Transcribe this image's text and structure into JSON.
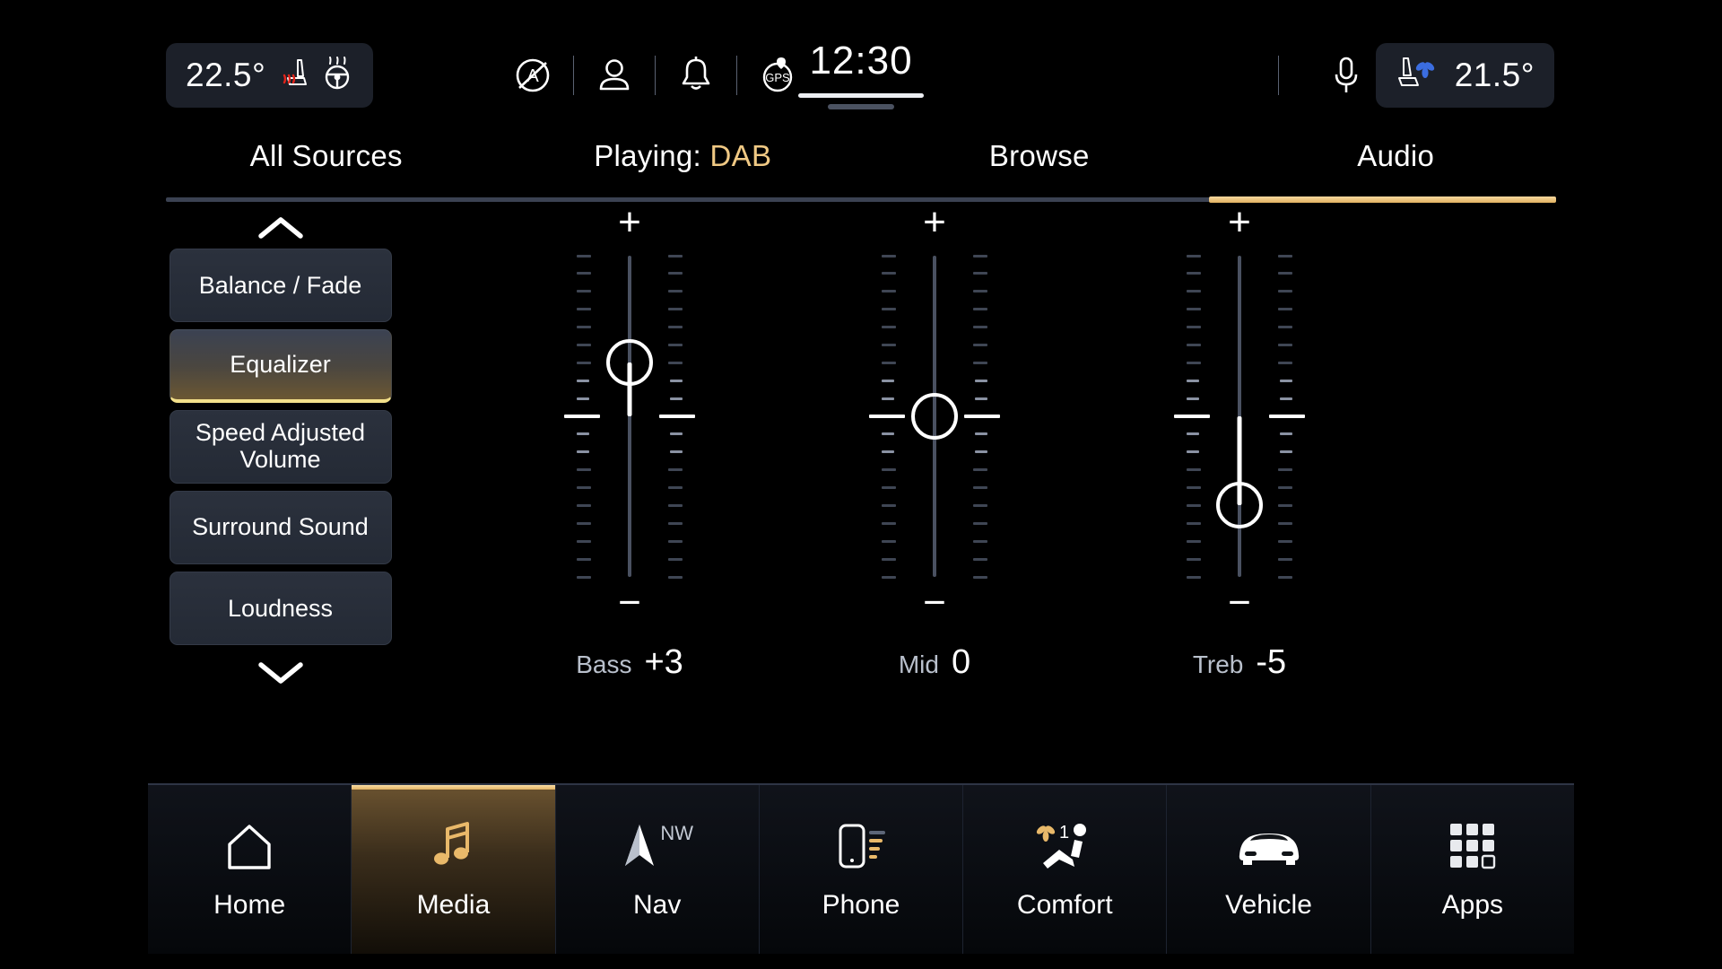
{
  "status_bar": {
    "left_climate": {
      "temperature": "22.5°",
      "icons": [
        "seat-heat-icon",
        "steering-wheel-heat-icon"
      ]
    },
    "right_climate": {
      "temperature": "21.5°",
      "icons": [
        "seat-vent-icon"
      ]
    },
    "center_icons": [
      "auto-stop-start-off-icon",
      "user-profile-icon",
      "notification-bell-icon",
      "gps-icon"
    ],
    "clock": "12:30",
    "mic_icon": "microphone-icon"
  },
  "tabs": [
    {
      "label": "All Sources",
      "active": false
    },
    {
      "label": "Playing:",
      "accent": "DAB",
      "active": false
    },
    {
      "label": "Browse",
      "active": false
    },
    {
      "label": "Audio",
      "active": true
    }
  ],
  "sidebar": {
    "scroll_up_icon": "chevron-up-icon",
    "scroll_down_icon": "chevron-down-icon",
    "items": [
      {
        "label": "Balance / Fade",
        "selected": false
      },
      {
        "label": "Equalizer",
        "selected": true
      },
      {
        "label": "Speed Adjusted Volume",
        "selected": false
      },
      {
        "label": "Surround Sound",
        "selected": false
      },
      {
        "label": "Loudness",
        "selected": false
      }
    ]
  },
  "equalizer": {
    "increase_label": "+",
    "decrease_label": "−",
    "range": {
      "min": -9,
      "max": 9
    },
    "bands": [
      {
        "name": "bass",
        "label": "Bass",
        "value": "+3",
        "numeric": 3
      },
      {
        "name": "mid",
        "label": "Mid",
        "value": "0",
        "numeric": 0
      },
      {
        "name": "treble",
        "label": "Treb",
        "value": "-5",
        "numeric": -5
      }
    ]
  },
  "bottom_nav": [
    {
      "label": "Home",
      "icon": "home-icon",
      "active": false
    },
    {
      "label": "Media",
      "icon": "music-note-icon",
      "active": true
    },
    {
      "label": "Nav",
      "icon": "navigation-arrow-icon",
      "badge": "NW",
      "active": false
    },
    {
      "label": "Phone",
      "icon": "phone-signal-icon",
      "active": false
    },
    {
      "label": "Comfort",
      "icon": "seat-climate-icon",
      "badge": "1",
      "active": false
    },
    {
      "label": "Vehicle",
      "icon": "car-front-icon",
      "active": false
    },
    {
      "label": "Apps",
      "icon": "apps-grid-icon",
      "active": false
    }
  ],
  "colors": {
    "accent_gold": "#f0c984",
    "background": "#000000",
    "panel": "#2b313d",
    "track": "#4a5161",
    "label_text": "#b9c0cc"
  }
}
